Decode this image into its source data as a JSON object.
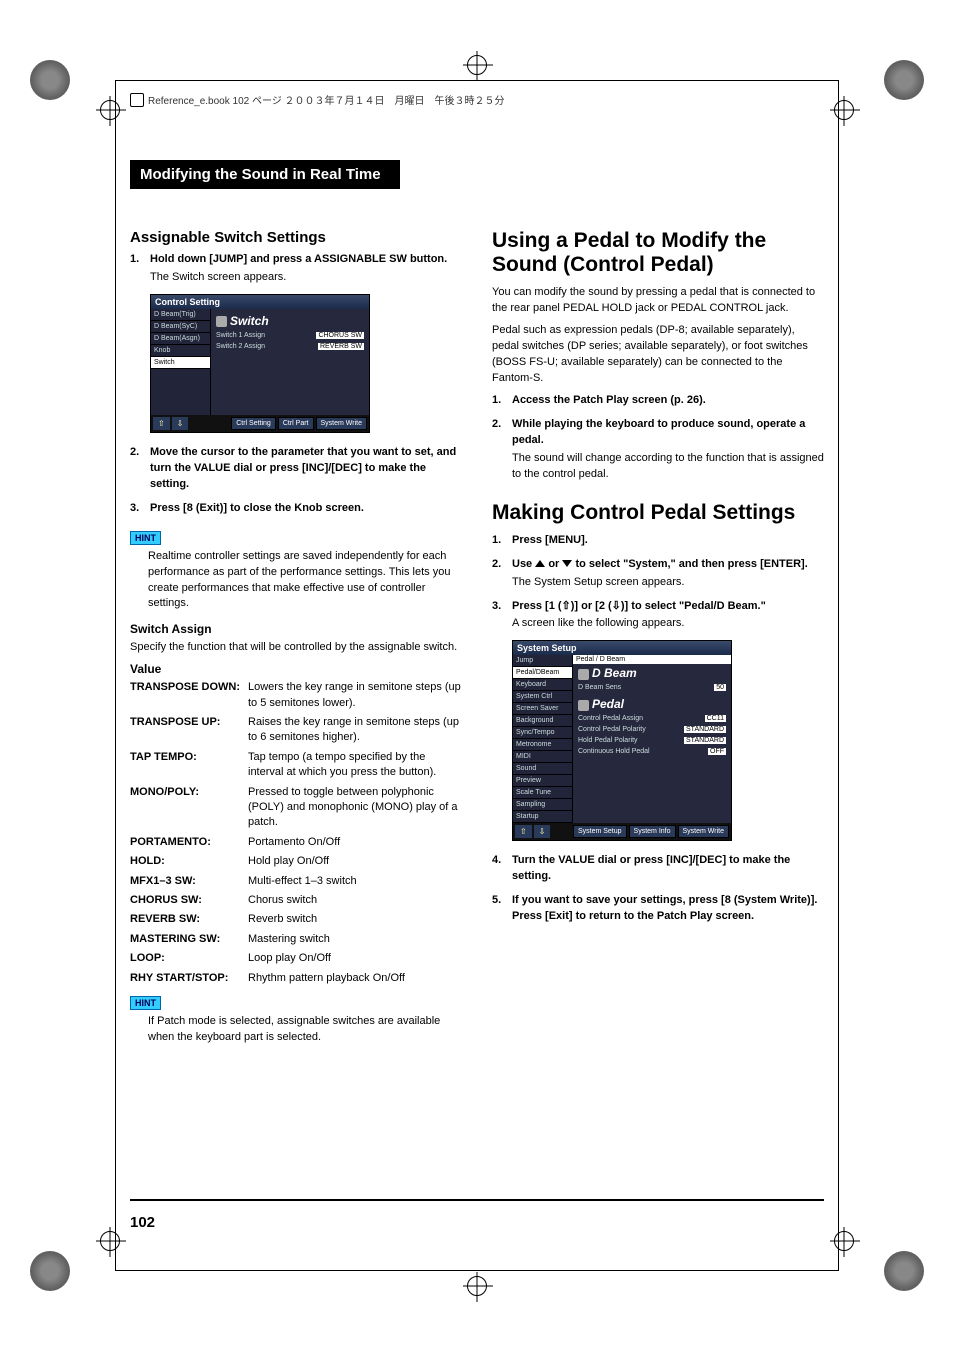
{
  "book_header": "Reference_e.book  102 ページ   ２００３年７月１４日　月曜日　午後３時２５分",
  "section_banner": "Modifying the Sound in Real Time",
  "page_number": "102",
  "left": {
    "h2": "Assignable Switch Settings",
    "steps": [
      {
        "num": "1.",
        "bold": "Hold down [JUMP] and press a ASSIGNABLE SW button.",
        "reg": "The Switch screen appears."
      },
      {
        "num": "2.",
        "bold": "Move the cursor to the parameter that you want to set, and turn the VALUE dial or press [INC]/[DEC] to make the setting."
      },
      {
        "num": "3.",
        "bold": "Press [8 (Exit)] to close the Knob screen."
      }
    ],
    "hint_label": "HINT",
    "hint": "Realtime controller settings are saved independently for each performance as part of the performance settings. This lets you create performances that make effective use of controller settings.",
    "switch_assign_h": "Switch Assign",
    "switch_assign_p": "Specify the function that will be controlled by the assignable switch.",
    "value_h": "Value",
    "params": [
      {
        "label": "TRANSPOSE DOWN:",
        "desc": "Lowers the key range in semitone steps (up to 5 semitones lower)."
      },
      {
        "label": "TRANSPOSE UP:",
        "desc": "Raises the key range in semitone steps (up to 6 semitones higher)."
      },
      {
        "label": "TAP TEMPO:",
        "desc": "Tap tempo (a tempo specified by the interval at which you press the button)."
      },
      {
        "label": "MONO/POLY:",
        "desc": "Pressed to toggle between polyphonic (POLY) and monophonic (MONO) play of a patch."
      },
      {
        "label": "PORTAMENTO:",
        "desc": "Portamento On/Off"
      },
      {
        "label": "HOLD:",
        "desc": "Hold play On/Off"
      },
      {
        "label": "MFX1–3 SW:",
        "desc": "Multi-effect 1–3 switch"
      },
      {
        "label": "CHORUS SW:",
        "desc": "Chorus switch"
      },
      {
        "label": "REVERB SW:",
        "desc": "Reverb switch"
      },
      {
        "label": "MASTERING SW:",
        "desc": "Mastering switch"
      },
      {
        "label": "LOOP:",
        "desc": "Loop play On/Off"
      },
      {
        "label": "RHY START/STOP:",
        "desc": "Rhythm pattern playback On/Off"
      }
    ],
    "hint2": "If Patch mode is selected, assignable switches are available when the keyboard part is selected.",
    "screenshot1": {
      "title": "Control Setting",
      "sidebar": [
        "D Beam(Trig)",
        "D Beam(SyC)",
        "D Beam(Asgn)",
        "Knob",
        "Switch"
      ],
      "sidebar_active": 4,
      "heading": "Switch",
      "rows": [
        {
          "l": "Switch 1 Assign",
          "r": "CHORUS SW"
        },
        {
          "l": "Switch 2 Assign",
          "r": "REVERB SW"
        }
      ],
      "footer": [
        "Ctrl Setting",
        "Ctrl Part",
        "System Write"
      ]
    }
  },
  "right": {
    "h1": "Using a Pedal to Modify the Sound (Control Pedal)",
    "intro1": "You can modify the sound by pressing a pedal that is connected to the rear panel PEDAL HOLD jack or PEDAL CONTROL jack.",
    "intro2": "Pedal such as expression pedals (DP-8; available separately), pedal switches (DP series; available separately), or foot switches (BOSS FS-U; available separately) can be connected to the Fantom-S.",
    "stepsA": [
      {
        "num": "1.",
        "bold": "Access the Patch Play screen (p. 26)."
      },
      {
        "num": "2.",
        "bold": "While playing the keyboard to produce sound, operate a pedal.",
        "reg": "The sound will change according to the function that is assigned to the control pedal."
      }
    ],
    "h1b": "Making Control Pedal Settings",
    "stepsB": [
      {
        "num": "1.",
        "bold": "Press [MENU]."
      },
      {
        "num": "2.",
        "bold_pre": "Use ",
        "bold_mid": " or ",
        "bold_post": " to select \"System,\" and then press [ENTER].",
        "reg": "The System Setup screen appears."
      },
      {
        "num": "3.",
        "bold": "Press [1 (⇧)] or [2 (⇩)] to select \"Pedal/D Beam.\"",
        "reg": "A screen like the following appears."
      }
    ],
    "stepsC": [
      {
        "num": "4.",
        "bold": "Turn the VALUE dial or press [INC]/[DEC] to make the setting."
      },
      {
        "num": "5.",
        "bold": "If you want to save your settings, press [8 (System Write)]. Press [Exit] to return to the Patch Play screen."
      }
    ],
    "screenshot2": {
      "title": "System Setup",
      "tab": "Pedal / D Beam",
      "sidebar": [
        "Jump",
        "Pedal/DBeam",
        "Keyboard",
        "System Ctrl",
        "Screen Saver",
        "Background",
        "Sync/Tempo",
        "Metronome",
        "MIDI",
        "Sound",
        "Preview",
        "Scale Tune",
        "Sampling",
        "Startup"
      ],
      "sidebar_active": 1,
      "heading1": "D Beam",
      "rows1": [
        {
          "l": "D Beam Sens",
          "r": "50"
        }
      ],
      "heading2": "Pedal",
      "rows2": [
        {
          "l": "Control Pedal Assign",
          "r": "CC11"
        },
        {
          "l": "Control Pedal Polarity",
          "r": "STANDARD"
        },
        {
          "l": "Hold Pedal Polarity",
          "r": "STANDARD"
        },
        {
          "l": "Continuous Hold Pedal",
          "r": "OFF"
        }
      ],
      "footer": [
        "System Setup",
        "System Info",
        "System Write"
      ]
    }
  }
}
